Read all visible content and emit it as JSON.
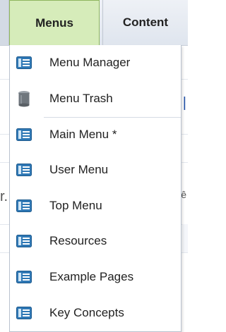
{
  "menubar": {
    "tabs": [
      {
        "label": "Menus"
      },
      {
        "label": "Content"
      }
    ]
  },
  "dropdown": {
    "items": [
      {
        "label": "Menu Manager",
        "icon": "menu-icon"
      },
      {
        "label": "Menu Trash",
        "icon": "trash-can-icon"
      },
      {
        "label": "Main Menu *",
        "icon": "menu-icon"
      },
      {
        "label": "User Menu",
        "icon": "menu-icon"
      },
      {
        "label": "Top Menu",
        "icon": "menu-icon"
      },
      {
        "label": "Resources",
        "icon": "menu-icon"
      },
      {
        "label": "Example Pages",
        "icon": "menu-icon"
      },
      {
        "label": "Key Concepts",
        "icon": "menu-icon"
      }
    ]
  },
  "colors": {
    "active_tab_bg": "#d6ecba",
    "active_tab_border": "#8eb55f",
    "icon_blue": "#2f78b5"
  }
}
